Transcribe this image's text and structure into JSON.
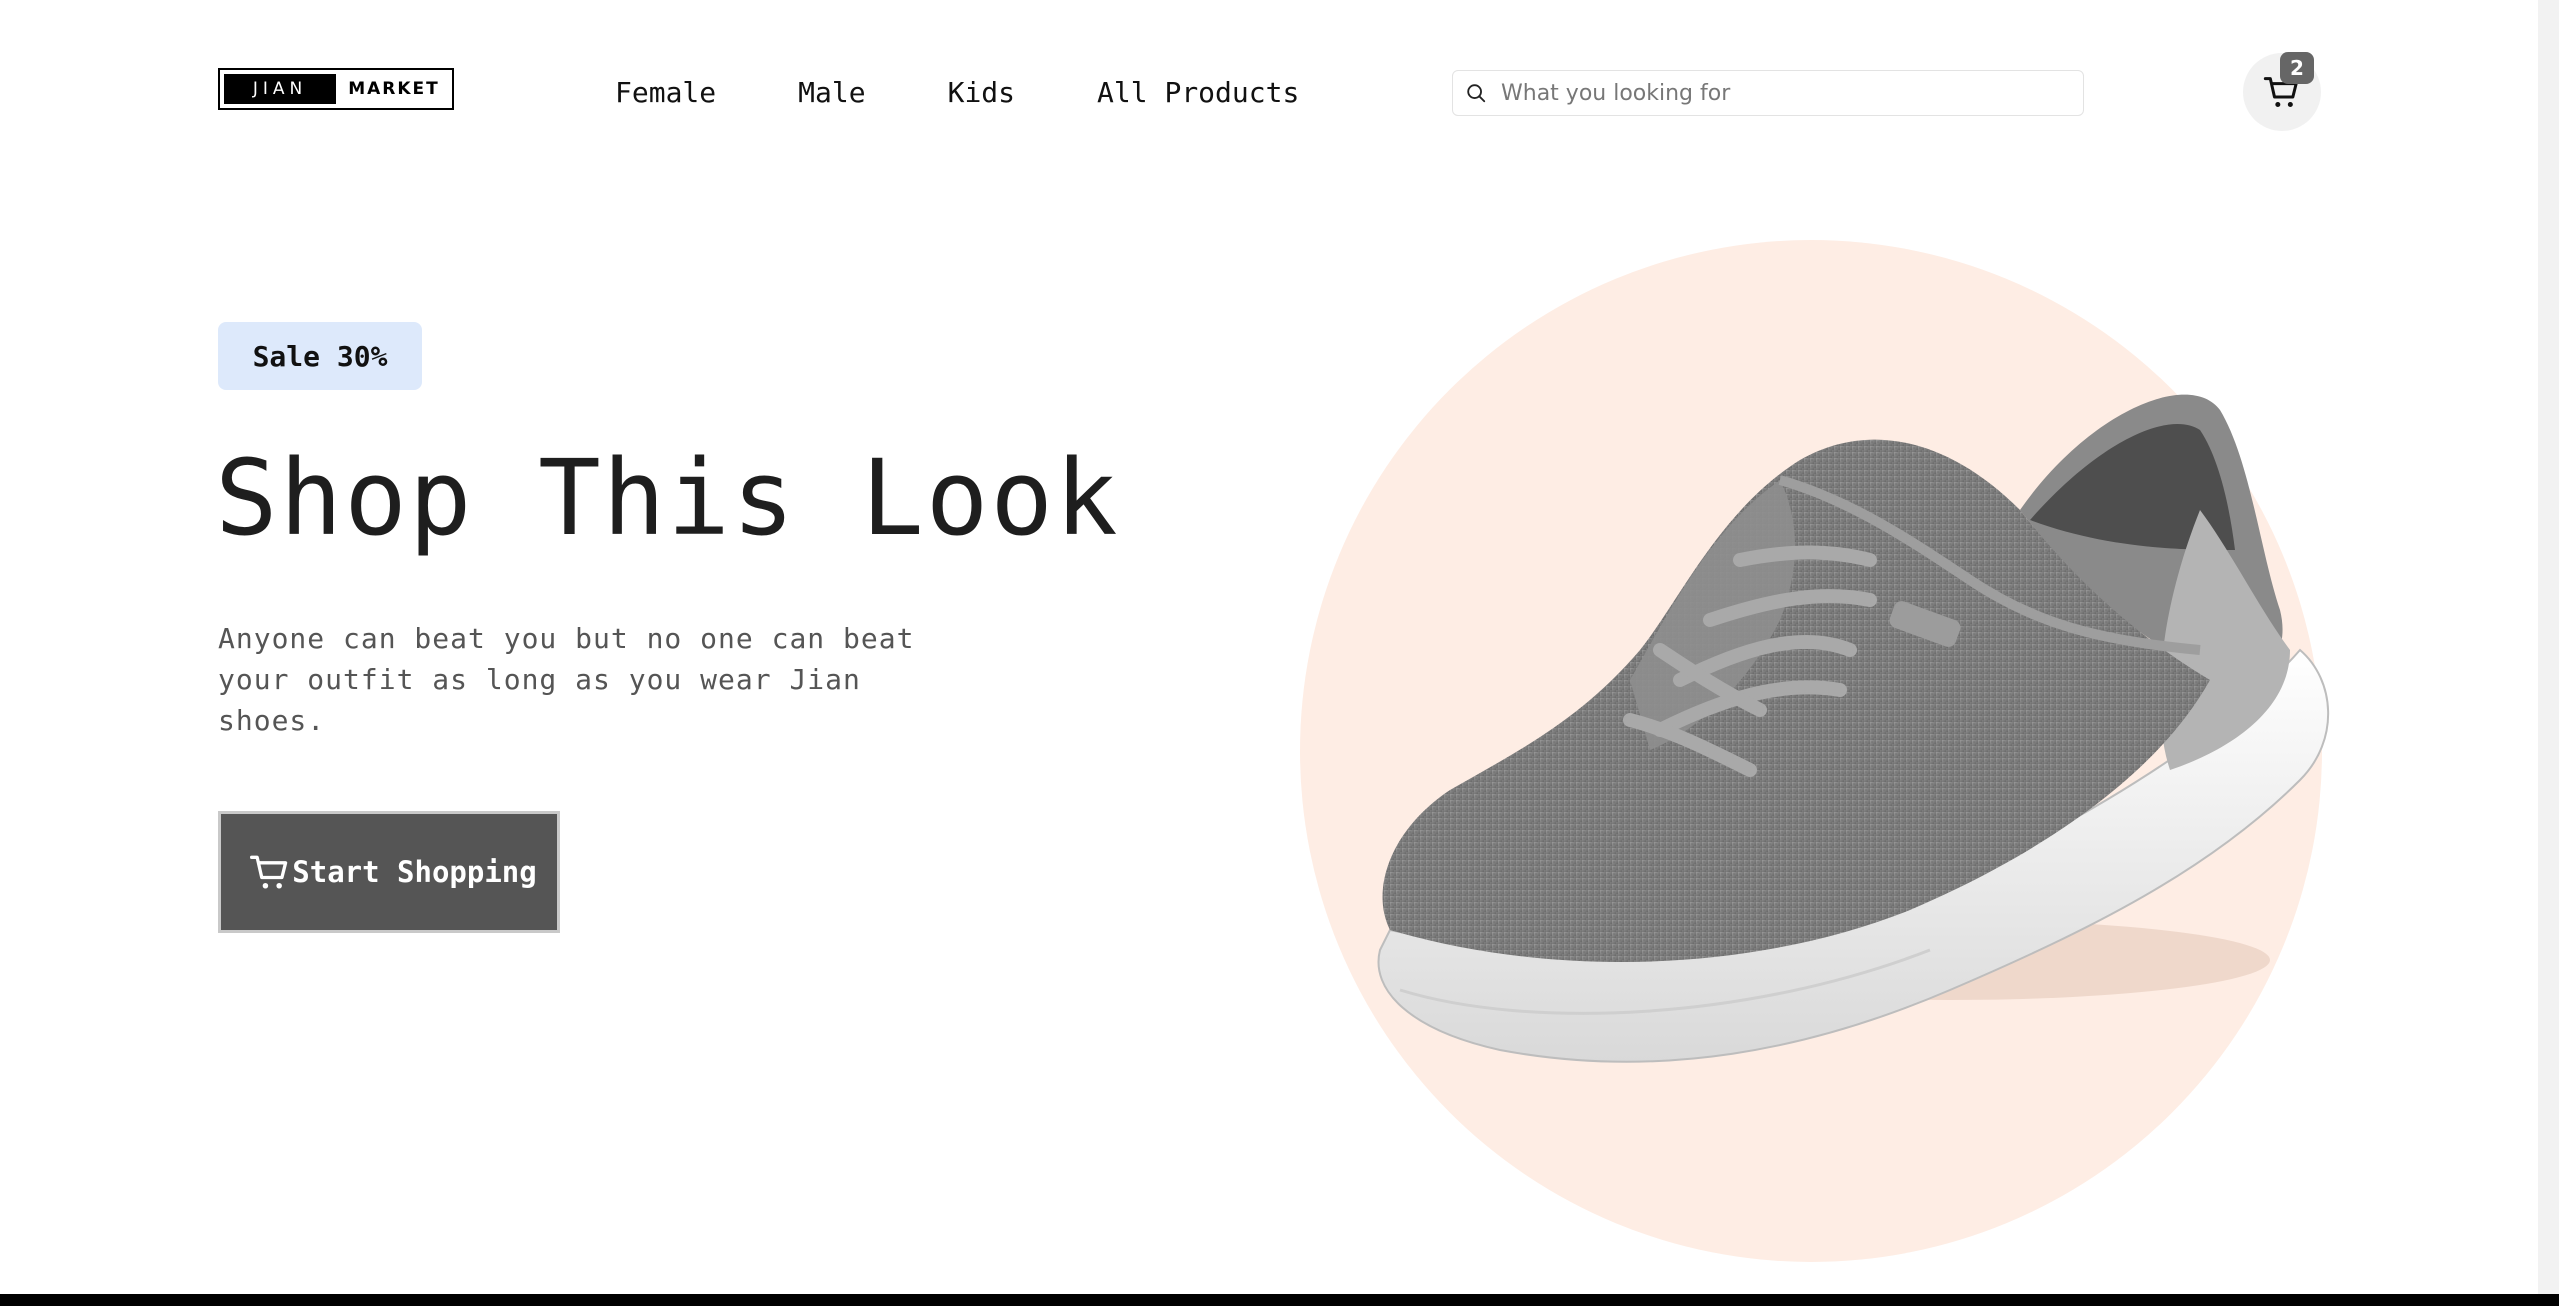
{
  "logo": {
    "left_text": "JIAN",
    "right_text": "MARKET"
  },
  "nav": {
    "items": [
      "Female",
      "Male",
      "Kids",
      "All Products"
    ]
  },
  "search": {
    "placeholder": "What you looking for"
  },
  "cart": {
    "count": "2"
  },
  "hero": {
    "badge": "Sale 30%",
    "title": "Shop This Look",
    "description": "Anyone can beat you but no one can beat your outfit as long as you wear Jian shoes.",
    "cta_label": "Start Shopping"
  },
  "colors": {
    "circle": "#feede4",
    "badge_bg": "#dde9fb",
    "cta_bg": "#555555",
    "cart_badge": "#666666"
  }
}
